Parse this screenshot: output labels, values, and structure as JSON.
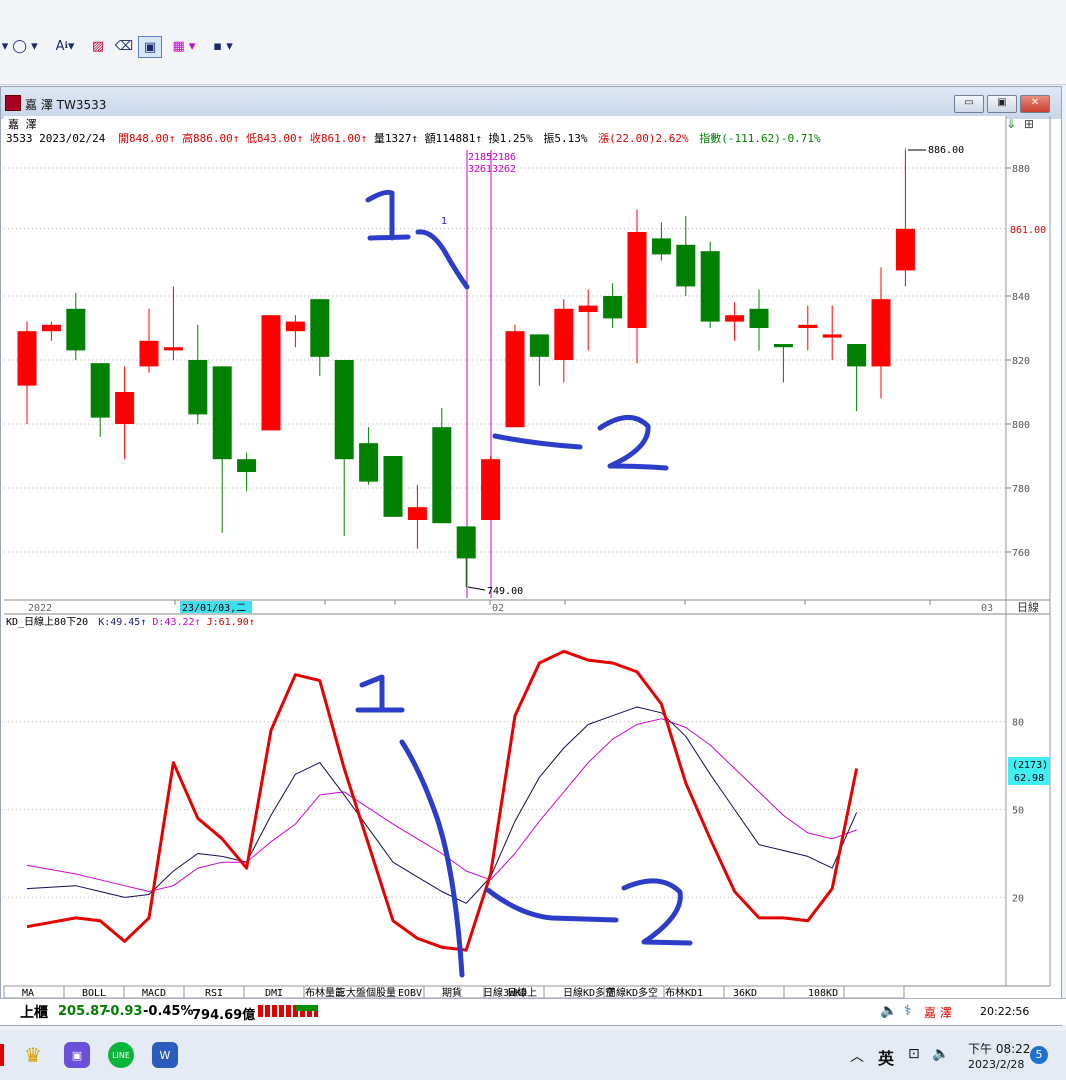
{
  "window": {
    "title": "嘉 澤 TW3533",
    "minimize": "▭",
    "restore": "▣",
    "close": "✕"
  },
  "quote": {
    "name": "嘉 澤",
    "code_date": "3533 2023/02/24",
    "open": "開848.00↑",
    "high": "高886.00↑",
    "low": "低843.00↑",
    "close": "收861.00↑",
    "volume": "量1327↑",
    "amount": "額114881↑",
    "turnover": "換1.25%",
    "amplitude": "振5.13%",
    "change": "漲(22.00)2.62%",
    "index": "指數(-111.62)-0.71%"
  },
  "price_axis": {
    "ticks": [
      "880",
      "840",
      "820",
      "800",
      "780",
      "760"
    ],
    "last_price_label": "861.00"
  },
  "annotations": {
    "high_label": "886.00",
    "low_label": "749.00",
    "cursor_top_a": "2185",
    "cursor_top_b": "2186",
    "cursor_bot_a": "3261",
    "cursor_bot_b": "3262",
    "small_marker": "1",
    "hand_1": "1",
    "hand_2": "2"
  },
  "date_axis": {
    "year_label": "2022",
    "cursor_date": "23/01/03,二",
    "feb_label": "02",
    "mar_label": "03",
    "period_button": "日線"
  },
  "kd": {
    "header_prefix": "KD_日線上80下20",
    "k_label": "K:49.45↑",
    "d_label": "D:43.22↑",
    "j_label": "J:61.90↑",
    "ticks": [
      "80",
      "50",
      "20"
    ],
    "cursor_value_a": "(2173)",
    "cursor_value_b": "62.98"
  },
  "indicator_tabs": [
    "MA",
    "BOLL",
    "MACD",
    "RSI",
    "DMI",
    "布林量能",
    "三大盤",
    "個股量",
    "EOBV",
    "期貨",
    "日線3WKD",
    "日線上",
    "日線KD多空",
    "周線KD多空",
    "布林KD1",
    "36KD",
    "108KD"
  ],
  "status": {
    "market": "上櫃",
    "index_value": "205.87",
    "index_change": "-0.93",
    "index_pct": "-0.45%",
    "turnover": "794.69億",
    "stock_name": "嘉 澤",
    "time": "20:22:56"
  },
  "taskbar": {
    "ime": "英",
    "clock_time": "下午 08:22",
    "clock_date": "2023/2/28",
    "notification_count": "5"
  },
  "colors": {
    "up": "#ff0000",
    "down": "#008000",
    "cursor": "#cc00cc",
    "ink": "#2c3ec9",
    "k_line": "#101050",
    "d_line": "#d000d0",
    "j_line": "#e60000"
  },
  "chart_data": {
    "type": "candlestick",
    "symbol": "TW3533",
    "price_ylim": [
      740,
      895
    ],
    "ohlc": [
      {
        "o": 812,
        "h": 832,
        "l": 800,
        "c": 829,
        "up": true
      },
      {
        "o": 829,
        "h": 832,
        "l": 826,
        "c": 831,
        "up": true
      },
      {
        "o": 836,
        "h": 841,
        "l": 820,
        "c": 823,
        "up": false
      },
      {
        "o": 819,
        "h": 819,
        "l": 796,
        "c": 802,
        "up": false
      },
      {
        "o": 800,
        "h": 818,
        "l": 789,
        "c": 810,
        "up": true
      },
      {
        "o": 818,
        "h": 836,
        "l": 816,
        "c": 826,
        "up": true
      },
      {
        "o": 823,
        "h": 843,
        "l": 820,
        "c": 824,
        "up": true
      },
      {
        "o": 820,
        "h": 831,
        "l": 800,
        "c": 803,
        "up": false
      },
      {
        "o": 818,
        "h": 818,
        "l": 766,
        "c": 789,
        "up": false
      },
      {
        "o": 789,
        "h": 791,
        "l": 779,
        "c": 785,
        "up": false
      },
      {
        "o": 798,
        "h": 834,
        "l": 798,
        "c": 834,
        "up": true
      },
      {
        "o": 829,
        "h": 834,
        "l": 824,
        "c": 832,
        "up": true
      },
      {
        "o": 839,
        "h": 839,
        "l": 815,
        "c": 821,
        "up": false
      },
      {
        "o": 820,
        "h": 820,
        "l": 765,
        "c": 789,
        "up": false
      },
      {
        "o": 794,
        "h": 799,
        "l": 781,
        "c": 782,
        "up": false
      },
      {
        "o": 790,
        "h": 790,
        "l": 771,
        "c": 771,
        "up": false
      },
      {
        "o": 770,
        "h": 781,
        "l": 761,
        "c": 774,
        "up": true
      },
      {
        "o": 799,
        "h": 805,
        "l": 769,
        "c": 769,
        "up": false
      },
      {
        "o": 768,
        "h": 768,
        "l": 749,
        "c": 758,
        "up": false
      },
      {
        "o": 770,
        "h": 790,
        "l": 770,
        "c": 789,
        "up": true
      },
      {
        "o": 799,
        "h": 831,
        "l": 799,
        "c": 829,
        "up": true
      },
      {
        "o": 828,
        "h": 828,
        "l": 812,
        "c": 821,
        "up": false
      },
      {
        "o": 820,
        "h": 839,
        "l": 813,
        "c": 836,
        "up": true
      },
      {
        "o": 835,
        "h": 842,
        "l": 823,
        "c": 837,
        "up": true
      },
      {
        "o": 840,
        "h": 844,
        "l": 830,
        "c": 833,
        "up": false
      },
      {
        "o": 830,
        "h": 867,
        "l": 819,
        "c": 860,
        "up": true
      },
      {
        "o": 858,
        "h": 863,
        "l": 851,
        "c": 853,
        "up": false
      },
      {
        "o": 856,
        "h": 865,
        "l": 840,
        "c": 843,
        "up": false
      },
      {
        "o": 854,
        "h": 857,
        "l": 830,
        "c": 832,
        "up": false
      },
      {
        "o": 832,
        "h": 838,
        "l": 826,
        "c": 834,
        "up": true
      },
      {
        "o": 836,
        "h": 842,
        "l": 823,
        "c": 830,
        "up": false
      },
      {
        "o": 825,
        "h": 825,
        "l": 813,
        "c": 824,
        "up": false
      },
      {
        "o": 830,
        "h": 837,
        "l": 823,
        "c": 831,
        "up": true
      },
      {
        "o": 828,
        "h": 837,
        "l": 820,
        "c": 827,
        "up": true
      },
      {
        "o": 825,
        "h": 825,
        "l": 804,
        "c": 818,
        "up": false
      },
      {
        "o": 818,
        "h": 849,
        "l": 808,
        "c": 839,
        "up": true
      },
      {
        "o": 848,
        "h": 886,
        "l": 843,
        "c": 861,
        "up": true
      }
    ],
    "kd_ylim": [
      0,
      100
    ],
    "kd_x": [
      0,
      2,
      3,
      4,
      5,
      6,
      7,
      8,
      9,
      10,
      11,
      12,
      13,
      15,
      16,
      17,
      18,
      19,
      20,
      21,
      22,
      23,
      24,
      25,
      26,
      27,
      28,
      29,
      30,
      31,
      32,
      33,
      34,
      35,
      36
    ],
    "series": [
      {
        "name": "K",
        "values": [
          23,
          24,
          22,
          20,
          21,
          29,
          35,
          34,
          32,
          48,
          62,
          66,
          55,
          32,
          27,
          22,
          18,
          27,
          46,
          61,
          71,
          79,
          82,
          85,
          83,
          75,
          62,
          50,
          38,
          36,
          34,
          30,
          49
        ]
      },
      {
        "name": "D",
        "values": [
          31,
          28,
          26,
          24,
          22,
          24,
          30,
          32,
          32,
          39,
          45,
          55,
          56,
          45,
          40,
          35,
          29,
          26,
          35,
          46,
          56,
          66,
          74,
          79,
          81,
          78,
          72,
          64,
          56,
          48,
          42,
          40,
          43
        ]
      },
      {
        "name": "J",
        "values": [
          10,
          13,
          12,
          5,
          13,
          66,
          47,
          40,
          30,
          77,
          96,
          94,
          64,
          12,
          6,
          3,
          2,
          28,
          82,
          100,
          104,
          101,
          100,
          97,
          86,
          59,
          40,
          22,
          13,
          13,
          12,
          23,
          64
        ]
      }
    ]
  }
}
